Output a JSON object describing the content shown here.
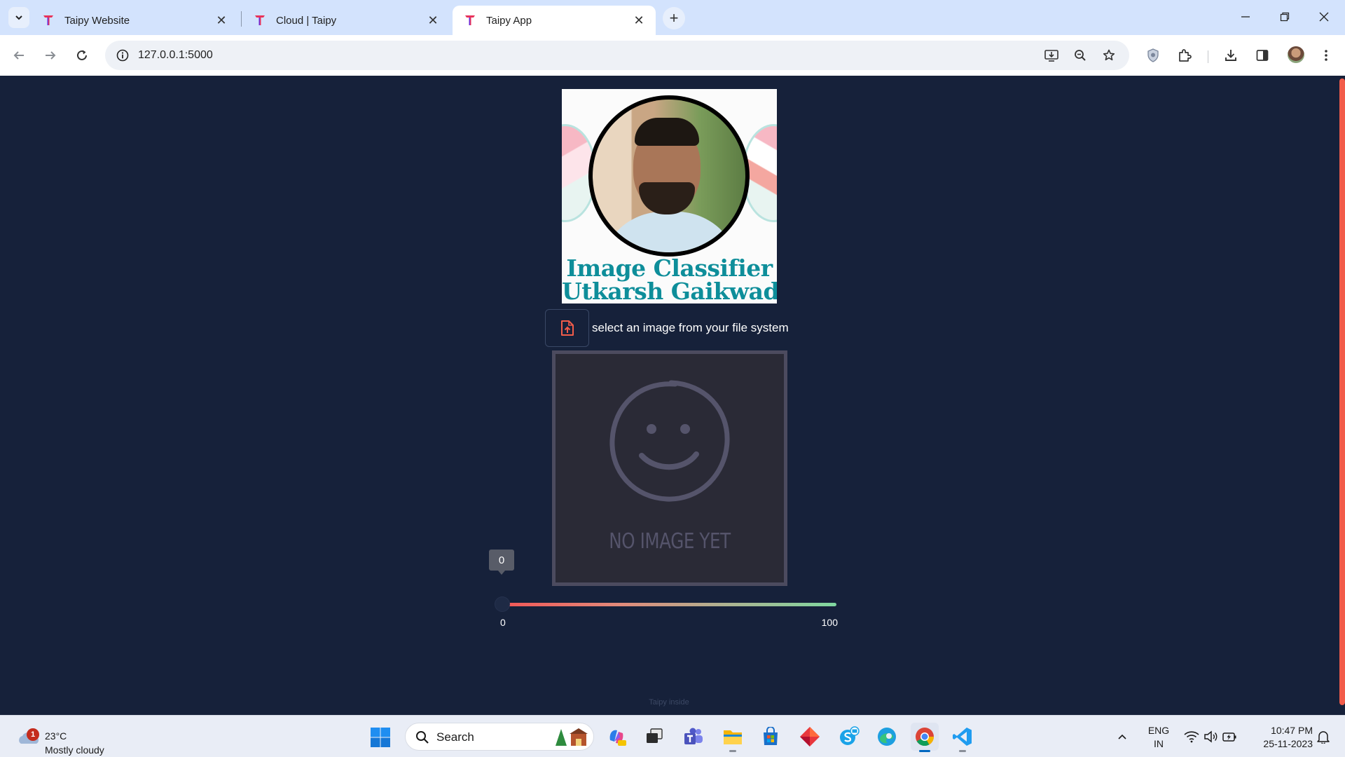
{
  "browser": {
    "tabs": [
      {
        "title": "Taipy Website",
        "active": false
      },
      {
        "title": "Cloud | Taipy",
        "active": false
      },
      {
        "title": "Taipy App",
        "active": true
      }
    ],
    "close_glyph": "✕",
    "new_tab_glyph": "+",
    "url": "127.0.0.1:5000"
  },
  "app": {
    "banner": {
      "line1": "Image Classifier",
      "line2": "Utkarsh Gaikwad"
    },
    "upload": {
      "label": "select an image from your file system",
      "icon": "file-upload-icon"
    },
    "image_placeholder": {
      "text": "NO IMAGE YET",
      "icon": "smiley-icon"
    },
    "slider": {
      "value": 0,
      "value_label": "0",
      "min_label": "0",
      "max_label": "100",
      "gradient_colors": [
        "#f25656",
        "#7fd8a0"
      ]
    },
    "footer": "Taipy inside"
  },
  "taskbar": {
    "weather": {
      "temp": "23°C",
      "condition": "Mostly cloudy",
      "badge": "1"
    },
    "search_placeholder": "Search",
    "apps": [
      "copilot-icon",
      "task-view-icon",
      "teams-icon",
      "file-explorer-icon",
      "store-icon",
      "app-icon",
      "skype-icon",
      "edge-icon",
      "chrome-icon",
      "vscode-icon"
    ],
    "language": {
      "line1": "ENG",
      "line2": "IN"
    },
    "clock": {
      "time": "10:47 PM",
      "date": "25-11-2023"
    }
  },
  "colors": {
    "page_bg": "#16213a",
    "accent": "#f25c4a",
    "banner_text": "#0e8e9a"
  }
}
